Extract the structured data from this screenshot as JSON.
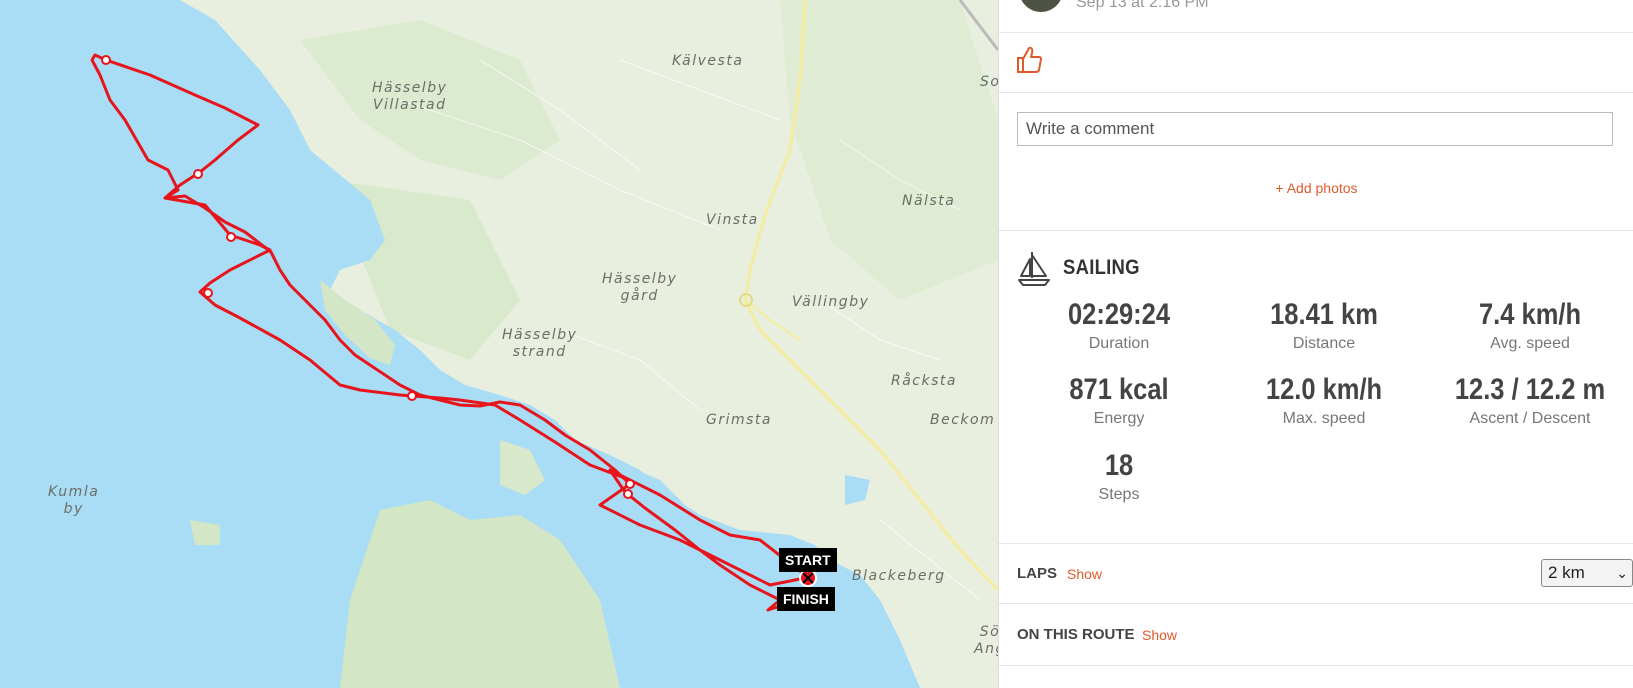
{
  "map": {
    "places": [
      {
        "id": "kalvesta",
        "lines": [
          "Kälvesta"
        ]
      },
      {
        "id": "hasselby-villastad",
        "lines": [
          "Hässelby",
          "Villastad"
        ]
      },
      {
        "id": "nalsta",
        "lines": [
          "Nälsta"
        ]
      },
      {
        "id": "vinsta",
        "lines": [
          "Vinsta"
        ]
      },
      {
        "id": "hasselby-gard",
        "lines": [
          "Hässelby",
          "gård"
        ]
      },
      {
        "id": "vallingby",
        "lines": [
          "Vällingby"
        ]
      },
      {
        "id": "hasselby-strand",
        "lines": [
          "Hässelby",
          "strand"
        ]
      },
      {
        "id": "rackstad",
        "lines": [
          "Råcksta"
        ]
      },
      {
        "id": "grimsta",
        "lines": [
          "Grimsta"
        ]
      },
      {
        "id": "beckom",
        "lines": [
          "Beckom"
        ]
      },
      {
        "id": "kumla-by",
        "lines": [
          "Kumla",
          "by"
        ]
      },
      {
        "id": "blackeberg",
        "lines": [
          "Blackeberg"
        ]
      },
      {
        "id": "so-top",
        "lines": [
          "So"
        ]
      },
      {
        "id": "so-bottom",
        "lines": [
          "Sö",
          "Ang"
        ]
      }
    ],
    "start_label": "START",
    "finish_label": "FINISH",
    "colors": {
      "water": "#a9dcf5",
      "land": "#e8efdf",
      "forest": "#d3e6c5",
      "route": "#e8141c",
      "road": "#f5ec9c"
    }
  },
  "header": {
    "timestamp": "Sep 13 at 2:16 PM"
  },
  "comment": {
    "placeholder": "Write a comment"
  },
  "add_photos": "+ Add photos",
  "activity": {
    "sport": "SAILING",
    "stats": [
      {
        "value": "02:29:24",
        "label": "Duration"
      },
      {
        "value": "18.41 km",
        "label": "Distance"
      },
      {
        "value": "7.4 km/h",
        "label": "Avg. speed"
      },
      {
        "value": "871 kcal",
        "label": "Energy"
      },
      {
        "value": "12.0 km/h",
        "label": "Max. speed"
      },
      {
        "value": "12.3 / 12.2 m",
        "label": "Ascent / Descent"
      },
      {
        "value": "18",
        "label": "Steps"
      }
    ]
  },
  "laps": {
    "label": "LAPS",
    "show": "Show",
    "select_value": "2 km"
  },
  "on_route": {
    "label": "ON THIS ROUTE",
    "show": "Show"
  },
  "accent_color": "#e05a2b"
}
